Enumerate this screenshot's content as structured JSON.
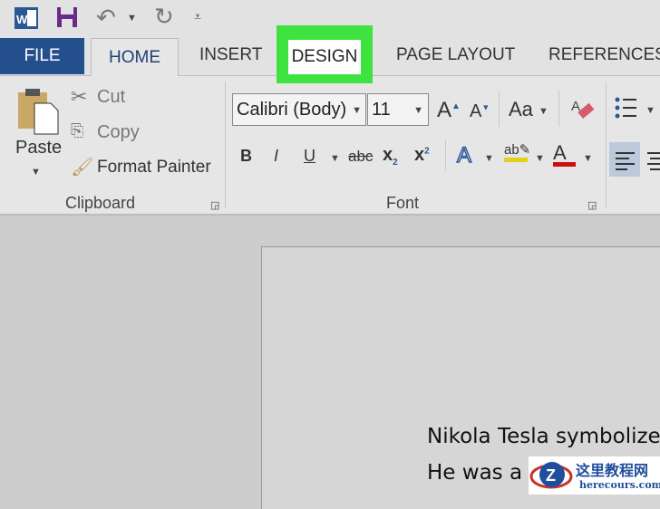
{
  "quick_access": {
    "icons": [
      "word-icon",
      "save-icon",
      "undo-icon",
      "redo-icon",
      "customize-icon"
    ]
  },
  "tabs": [
    "FILE",
    "HOME",
    "INSERT",
    "DESIGN",
    "PAGE LAYOUT",
    "REFERENCES"
  ],
  "highlight_color": "#3fe33f",
  "clipboard": {
    "paste": "Paste",
    "cut": "Cut",
    "copy": "Copy",
    "format_painter": "Format Painter",
    "group": "Clipboard"
  },
  "font": {
    "name": "Calibri (Body)",
    "size": "11",
    "case": "Aa",
    "strike": "abc",
    "group": "Font",
    "highlight_color": "#e0d21a",
    "font_color": "#cc1111"
  },
  "document": {
    "lines": [
      "Nikola Tesla symbolize",
      "He was a f"
    ]
  },
  "watermark": {
    "title": "这里教程网",
    "url": "herecours.com"
  }
}
